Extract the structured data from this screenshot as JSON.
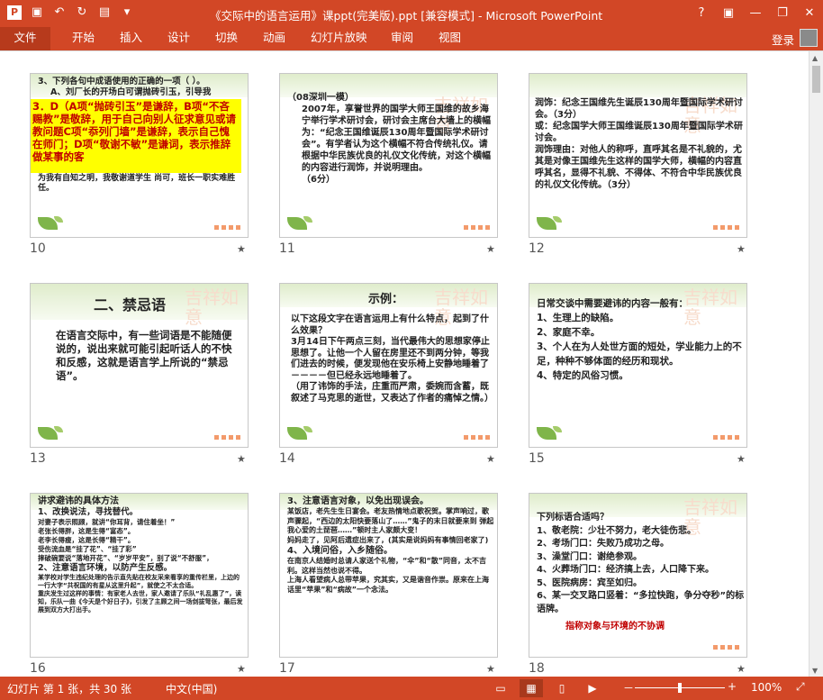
{
  "app": {
    "title": "《交际中的语言运用》课ppt(完美版).ppt [兼容模式] - Microsoft PowerPoint",
    "colors": {
      "accent": "#d24726"
    }
  },
  "qat_icons": [
    "save-icon",
    "undo-icon",
    "redo-icon",
    "customize-icon"
  ],
  "window": {
    "minimize": "—",
    "restore": "❐",
    "close": "✕",
    "help": "?"
  },
  "ribbon": {
    "tabs": [
      "文件",
      "开始",
      "插入",
      "设计",
      "切换",
      "动画",
      "幻灯片放映",
      "审阅",
      "视图"
    ],
    "login": "登录"
  },
  "slides": [
    {
      "number": "10",
      "lines": [
        "3、下列各句中成语使用的正确的一项（    ）。",
        "A、刘厂长的开场白可谓抛砖引玉，引导我"
      ],
      "answer": "3．D（A项“抛砖引玉”是谦辞，B项“不吝赐教”是敬辞，用于自己向别人征求意见或请教问题C项“忝列门墙”是谦辞，表示自己愧在师门；D项“敬谢不敏”是谦词，表示推辞做某事的客",
      "tail": [
        "为我有自知之明，我敬谢道学生 尚可，班长一职实难胜任。"
      ]
    },
    {
      "number": "11",
      "lines": [
        "（08深圳一模）",
        "2007年，享誉世界的国学大师王国维的故乡海宁举行学术研讨会，研讨会主席台大墙上的横幅为：“纪念王国维诞辰130周年暨国际学术研讨会”。有学者认为这个横幅不符合传统礼仪。请根据中华民族优良的礼仪文化传统，对这个横幅的内容进行润饰，并说明理由。",
        "（6分）"
      ]
    },
    {
      "number": "12",
      "lines": [
        "润饰：纪念王国维先生诞辰130周年暨国际学术研讨会。（3分）",
        "或：纪念国学大师王国维诞辰130周年暨国际学术研讨会。",
        "润饰理由：对他人的称呼，直呼其名是不礼貌的，尤其是对像王国维先生这样的国学大师，横幅的内容直呼其名，显得不礼貌、不得体、不符合中华民族优良的礼仪文化传统。（3分）"
      ]
    },
    {
      "number": "13",
      "heading": "二、禁忌语",
      "lines": [
        "在语言交际中，有一些词语是不能随便说的，说出来就可能引起听话人的不快和反感，这就是语言学上所说的“禁忌语”。"
      ]
    },
    {
      "number": "14",
      "heading": "示例：",
      "lines": [
        "以下这段文字在语言运用上有什么特点，起到了什么效果？",
        "3月14日下午两点三刻，当代最伟大的思想家停止思想了。让他一个人留在房里还不到两分钟，等我们进去的时候，便发现他在安乐椅上安静地睡着了－－－－但已经永远地睡着了。",
        "（用了讳饰的手法，庄重而严肃，委婉而含蓄，既叙述了马克思的逝世，又表达了作者的痛悼之情。）"
      ]
    },
    {
      "number": "15",
      "lines": [
        "日常交谈中需要避讳的内容一般有：",
        "1、生理上的缺陷。",
        "2、家庭不幸。",
        "3、个人在为人处世方面的短处，学业能力上的不足，种种不够体面的经历和现状。",
        "4、特定的风俗习惯。"
      ]
    },
    {
      "number": "16",
      "lines": [
        "讲求避讳的具体方法",
        "1、改换说法，寻找替代。",
        "对妻子表示照顾，就讲“你耳背，请住着坐！”",
        "老张长得胖，这是生得“富态”。",
        "老李长得瘦，这是长得“精干”。",
        "受伤流血是“挂了花”、“挂了彩”",
        "摔破碗要说“落地开花”、“岁岁平安”，别了说“不舒服”，",
        "2、注意语言环境，以防产生反感。",
        "某学校对学生违纪处理的告示直先贴在校友采来看享的重传栏里，上边的一行大字“共祝国的有星从这里升起”，就使之不太合适。",
        "重庆发生过这样的事情：有家老人去世，家人邀请了乐队“礼乱惠了”，读知，乐队一曲《今天是个好日子》，引发了主顾之间一场剑拔弩张，最后发展到双方大打出手。"
      ]
    },
    {
      "number": "17",
      "lines": [
        "3、注意语言对象，以免出现误会。",
        "某饭店，老先生生日宴会。老友热情地点歌祝贺。掌声响过，歌声骤起，“西边的太阳快要落山了……”鬼子的末日就要来到 弹起我心爱的土琵琶……”顿时主人家颇大变！",
        "妈妈走了，见阿后遗症出来了，(其实是说妈妈有事情回老家了)",
        "4、入境问俗，入乡随俗。",
        "在南京人结婚时总请人家送个礼物，“伞”和“散”同音，太不吉利。这样当然也说不得。",
        "上海人看望病人总带苹果，究其实，又是谐音作祟。原来在上海话里“苹果”和“病故”一个念法。"
      ]
    },
    {
      "number": "18",
      "lines": [
        "下列标语合适吗？",
        "1、敬老院：少壮不努力，老大徒伤悲。",
        "2、考场门口：失败乃成功之母。",
        "3、澡堂门口：谢绝参观。",
        "4、火葬场门口：经济搞上去，人口降下来。",
        "5、医院病房：宾至如归。",
        "6、某一交叉路口竖着：“多拉快跑，争分夺秒”的标语牌。"
      ],
      "note": "指称对象与环境的不协调"
    }
  ],
  "status": {
    "slide_info": "幻灯片 第 1 张，共 30 张",
    "language": "中文(中国)",
    "zoom": "100%",
    "zoom_minus": "－",
    "zoom_plus": "+"
  },
  "watermark": "吉祥如意"
}
